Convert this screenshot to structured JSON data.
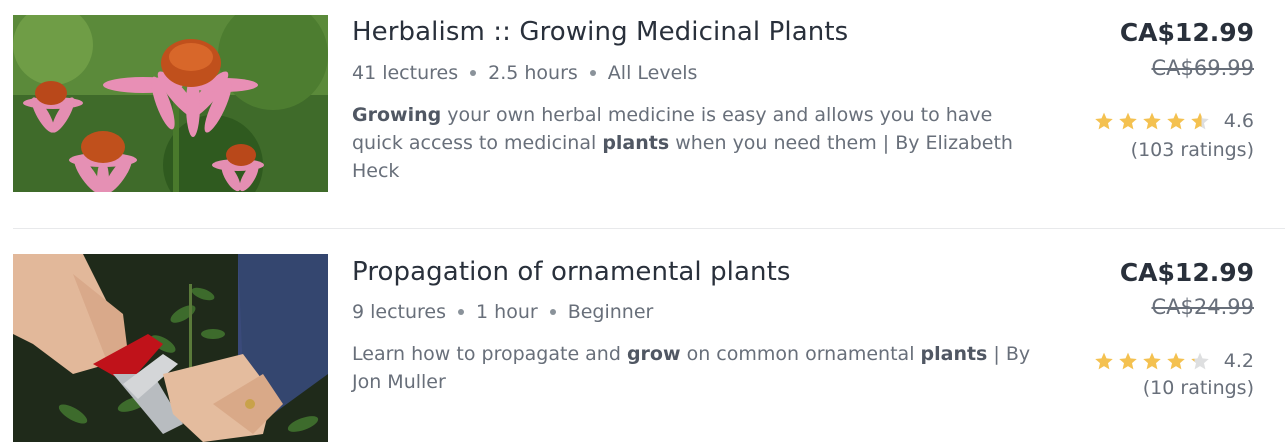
{
  "courses": [
    {
      "title": "Herbalism :: Growing Medicinal Plants",
      "lectures": "41 lectures",
      "duration": "2.5 hours",
      "level": "All Levels",
      "description": {
        "b1": "Growing",
        "t1": " your own herbal medicine is easy and allows you to have quick access to medicinal ",
        "b2": "plants",
        "t2": " when you need them | By Elizabeth Heck"
      },
      "price": "CA$12.99",
      "original_price": "CA$69.99",
      "rating": "4.6",
      "rating_fill": 0.6,
      "ratings_count": "(103 ratings)"
    },
    {
      "title": "Propagation of ornamental plants",
      "lectures": "9 lectures",
      "duration": "1 hour",
      "level": "Beginner",
      "description": {
        "t0": "Learn how to propagate and ",
        "b1": "grow",
        "t1": " on common ornamental ",
        "b2": "plants",
        "t2": " | By Jon Muller"
      },
      "price": "CA$12.99",
      "original_price": "CA$24.99",
      "rating": "4.2",
      "rating_fill": 0.2,
      "ratings_count": "(10 ratings)"
    }
  ],
  "colors": {
    "star": "#f4c150",
    "star_empty": "#dedfe0",
    "text": "#29303b",
    "muted": "#686f7a"
  },
  "icons": {
    "star": "star-icon",
    "half_star": "star-half-icon",
    "bullet": "bullet-dot-icon"
  }
}
